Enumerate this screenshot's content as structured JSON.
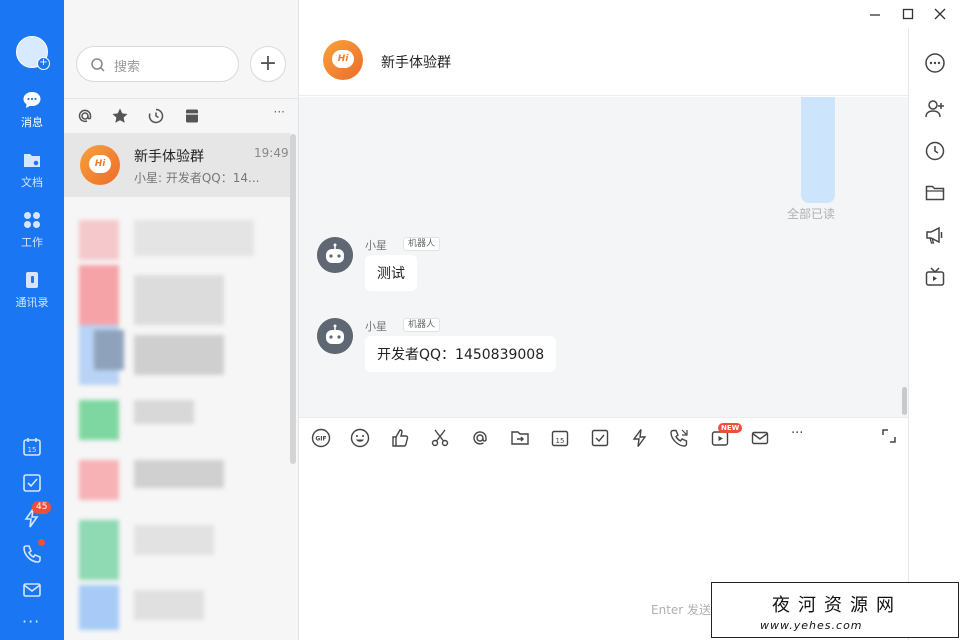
{
  "rail": {
    "items": [
      {
        "label": "消息",
        "icon": "chat-bubble-icon"
      },
      {
        "label": "文档",
        "icon": "folder-icon"
      },
      {
        "label": "工作",
        "icon": "grid-icon"
      },
      {
        "label": "通讯录",
        "icon": "contacts-icon"
      }
    ],
    "tools": [
      "calendar-icon",
      "checkbox-icon",
      "lightning-icon",
      "phone-icon",
      "mail-icon"
    ],
    "badge_count": "45",
    "more": "···"
  },
  "list": {
    "search_placeholder": "搜索",
    "add": "+",
    "filter_more": "···",
    "conversation": {
      "avatar_text": "Hi",
      "name": "新手体验群",
      "time": "19:49",
      "preview": "小星: 开发者QQ：14..."
    }
  },
  "chat": {
    "avatar_text": "Hi",
    "title": "新手体验群",
    "read_state": "全部已读",
    "messages": [
      {
        "sender": "小星",
        "tag": "机器人",
        "text": "测试"
      },
      {
        "sender": "小星",
        "tag": "机器人",
        "text": "开发者QQ：1450839008"
      }
    ],
    "toolbar": [
      "gif-icon",
      "emoji-icon",
      "thumbs-up-icon",
      "scissors-icon",
      "at-icon",
      "folder-send-icon",
      "calendar-icon",
      "task-icon",
      "lightning-icon",
      "phone-icon",
      "video-icon",
      "mail-icon",
      "more-icon"
    ],
    "new_label": "NEW",
    "more": "···",
    "input_hint": "Enter 发送，Ctrl+Enter 换行"
  },
  "watermark": {
    "title": "夜河资源网",
    "url": "www.yehes.com"
  },
  "colors": {
    "accent": "#1a76f2",
    "badge": "#f04d3a",
    "hi_avatar": "#ee6b2c"
  }
}
